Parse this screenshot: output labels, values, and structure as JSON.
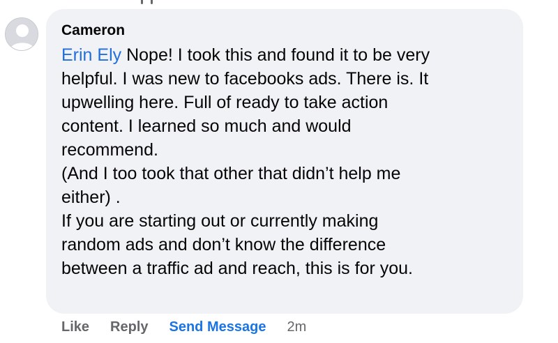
{
  "comment": {
    "author": "Cameron",
    "mention": "Erin Ely",
    "lines": [
      " Nope! I took this and found it to be very",
      "helpful. I was new to facebooks ads. There is. It",
      "upwelling here. Full of ready to take action",
      "content. I learned so much and would",
      "recommend.",
      "(And I too took that other that didn’t help me",
      "either) .",
      "If you are starting out or currently making",
      "random ads and don’t know the difference",
      "between a traffic ad and reach, this is for you."
    ]
  },
  "actions": {
    "like": "Like",
    "reply": "Reply",
    "send_message": "Send Message",
    "time": "2m"
  },
  "colors": {
    "bubble": "#f0f2f5",
    "mention": "#216fdb",
    "send_message": "#1b74e4",
    "meta": "#65676b"
  },
  "icons": {
    "avatar": "default-profile-icon"
  }
}
